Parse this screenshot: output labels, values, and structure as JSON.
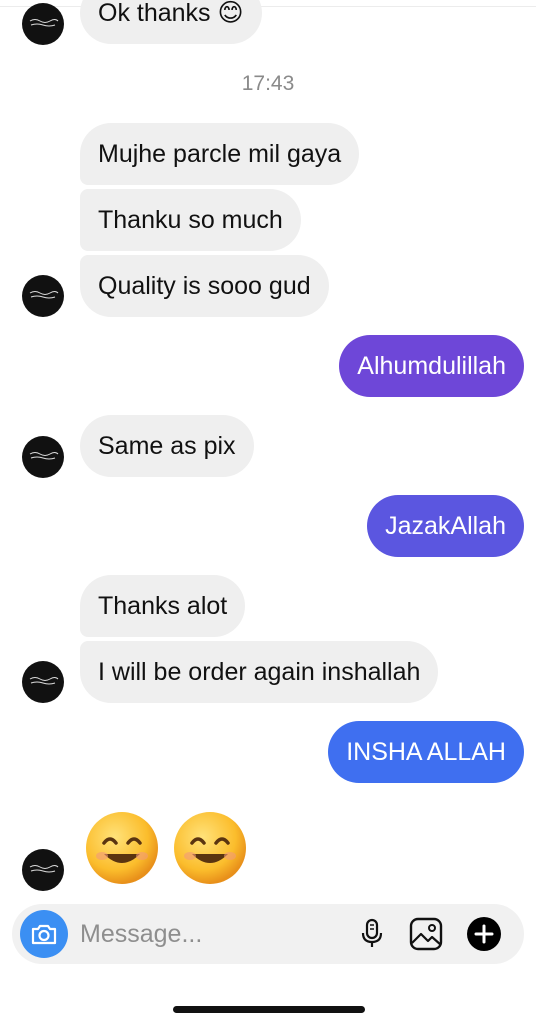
{
  "timestamp": "17:43",
  "colors": {
    "incoming_bg": "#efefef",
    "out_violet": "#6e47d8",
    "out_indigo": "#5b56e0",
    "out_blue": "#3f6ff0",
    "camera_blue": "#3b8ff3"
  },
  "messages": {
    "m0": {
      "text": "Ok thanks 😊"
    },
    "m1": {
      "text": "Mujhe parcle mil gaya"
    },
    "m2": {
      "text": "Thanku so much"
    },
    "m3": {
      "text": "Quality is sooo gud"
    },
    "m4": {
      "text": "Alhumdulillah"
    },
    "m5": {
      "text": "Same as pix"
    },
    "m6": {
      "text": "JazakAllah"
    },
    "m7": {
      "text": "Thanks alot"
    },
    "m8": {
      "text": "I will be order again inshallah"
    },
    "m9": {
      "text": "INSHA ALLAH"
    },
    "m10": {
      "emojis": [
        "smiling-face-icon",
        "smiling-face-icon"
      ]
    }
  },
  "composer": {
    "placeholder": "Message...",
    "icons": [
      "camera-icon",
      "microphone-icon",
      "gallery-icon",
      "plus-icon"
    ]
  }
}
